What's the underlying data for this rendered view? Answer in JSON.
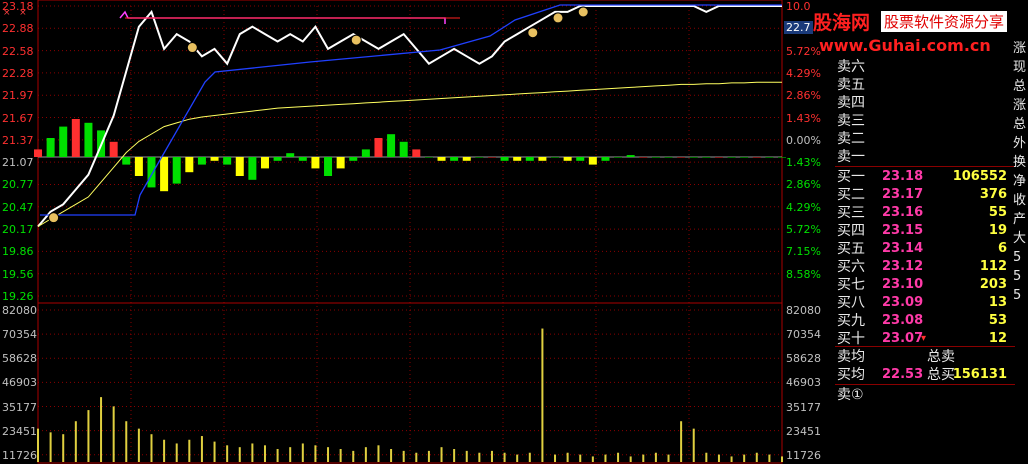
{
  "chart_data": {
    "type": "line",
    "title": "",
    "price_axis_left": [
      "23.18",
      "22.88",
      "22.58",
      "22.28",
      "21.97",
      "21.67",
      "21.37",
      "21.07",
      "20.77",
      "20.47",
      "20.17",
      "19.86",
      "19.56",
      "19.26"
    ],
    "pct_axis_right": [
      "10.0",
      "",
      "5.72%",
      "4.29%",
      "2.86%",
      "1.43%",
      "0.00%",
      "1.43%",
      "2.86%",
      "4.29%",
      "5.72%",
      "7.15%",
      "8.58%",
      ""
    ],
    "current_price_tag": "22.7",
    "volume_axis_left": [
      "82080",
      "70354",
      "58628",
      "46903",
      "35177",
      "23451",
      "11726"
    ],
    "volume_axis_right": [
      "82080",
      "70354",
      "58628",
      "46903",
      "35177",
      "23451",
      "11726"
    ],
    "series": [
      {
        "values": [
          20.2,
          20.4,
          20.5,
          20.7,
          20.9,
          21.3,
          21.7,
          22.3,
          22.9,
          23.1,
          22.6,
          22.8,
          22.7,
          22.5,
          22.6,
          22.4,
          22.8,
          22.9,
          22.8,
          22.7,
          22.8,
          22.7,
          22.9,
          22.6,
          22.7,
          22.8,
          22.7,
          22.6,
          22.7,
          22.8,
          22.6,
          22.4,
          22.5,
          22.6,
          22.5,
          22.4,
          22.5,
          22.7,
          22.8,
          22.9,
          23.0,
          23.1,
          23.1,
          23.18,
          23.18,
          23.18,
          23.18,
          23.18,
          23.18,
          23.18,
          23.18,
          23.18,
          23.18,
          23.1,
          23.18,
          23.18,
          23.18,
          23.18,
          23.18,
          23.18
        ]
      },
      {
        "values": [
          20.2,
          20.3,
          20.4,
          20.5,
          20.6,
          20.8,
          21.0,
          21.2,
          21.35,
          21.45,
          21.55,
          21.6,
          21.65,
          21.68,
          21.7,
          21.72,
          21.74,
          21.76,
          21.78,
          21.8,
          21.81,
          21.82,
          21.83,
          21.84,
          21.85,
          21.86,
          21.87,
          21.88,
          21.89,
          21.9,
          21.91,
          21.92,
          21.93,
          21.94,
          21.95,
          21.96,
          21.97,
          21.98,
          21.99,
          22.0,
          22.01,
          22.02,
          22.03,
          22.04,
          22.05,
          22.06,
          22.07,
          22.08,
          22.09,
          22.1,
          22.11,
          22.12,
          22.12,
          22.13,
          22.13,
          22.14,
          22.14,
          22.15,
          22.15,
          22.15
        ]
      }
    ],
    "macd": [
      0.2,
      0.5,
      0.8,
      1.0,
      0.9,
      0.7,
      0.4,
      -0.2,
      -0.5,
      -0.8,
      -0.9,
      -0.7,
      -0.4,
      -0.2,
      -0.1,
      -0.2,
      -0.5,
      -0.6,
      -0.3,
      -0.1,
      0.1,
      -0.1,
      -0.3,
      -0.5,
      -0.3,
      -0.1,
      0.2,
      0.5,
      0.6,
      0.4,
      0.2,
      0.0,
      -0.1,
      -0.1,
      -0.1,
      0.0,
      0.0,
      -0.1,
      -0.1,
      -0.1,
      -0.1,
      0.0,
      -0.1,
      -0.1,
      -0.2,
      -0.1,
      0.0,
      0.05,
      0.0,
      0.0,
      0.0,
      0.0,
      0.0,
      0.0,
      0.0,
      0.0,
      0.0,
      0.0,
      0.0,
      0.0
    ],
    "volume": [
      18,
      16,
      15,
      22,
      28,
      35,
      30,
      22,
      18,
      15,
      12,
      10,
      12,
      14,
      11,
      9,
      8,
      10,
      9,
      7,
      8,
      10,
      9,
      8,
      7,
      6,
      8,
      9,
      7,
      6,
      5,
      6,
      8,
      7,
      6,
      5,
      6,
      5,
      4,
      5,
      72,
      4,
      5,
      4,
      3,
      4,
      5,
      3,
      4,
      5,
      4,
      22,
      18,
      5,
      4,
      3,
      4,
      5,
      4,
      3
    ],
    "ylim": [
      19.26,
      23.18
    ]
  },
  "orderbook": {
    "sell_labels": [
      "卖六",
      "卖五",
      "卖四",
      "卖三",
      "卖二",
      "卖一"
    ],
    "buy": [
      {
        "name": "买一",
        "price": "23.18",
        "vol": "106552"
      },
      {
        "name": "买二",
        "price": "23.17",
        "vol": "376"
      },
      {
        "name": "买三",
        "price": "23.16",
        "vol": "55"
      },
      {
        "name": "买四",
        "price": "23.15",
        "vol": "19"
      },
      {
        "name": "买五",
        "price": "23.14",
        "vol": "6"
      },
      {
        "name": "买六",
        "price": "23.12",
        "vol": "112"
      },
      {
        "name": "买七",
        "price": "23.10",
        "vol": "203"
      },
      {
        "name": "买八",
        "price": "23.09",
        "vol": "13"
      },
      {
        "name": "买九",
        "price": "23.08",
        "vol": "53"
      },
      {
        "name": "买十",
        "price": "23.07",
        "vol": "12"
      }
    ],
    "avg_sell_label": "卖均",
    "total_sell_label": "总卖",
    "avg_buy_label": "买均",
    "avg_buy_price": "22.53",
    "total_buy_label": "总买",
    "total_buy_vol": "156131",
    "sell_queue_label": "卖①"
  },
  "right_column": [
    "涨",
    "现",
    "总",
    "涨",
    "总",
    "外",
    "换",
    "净",
    "收",
    "产",
    "大",
    "5",
    "5",
    "5"
  ],
  "logo": {
    "title": "股海网",
    "sub": "股票软件资源分享",
    "url": "www.Guhai.com.cn"
  },
  "colors": {
    "up": "#ff3030",
    "down": "#00e000",
    "price_line": "#ffffff",
    "avg_line": "#ffff60",
    "bg": "#000000",
    "grid": "#8a0000"
  }
}
